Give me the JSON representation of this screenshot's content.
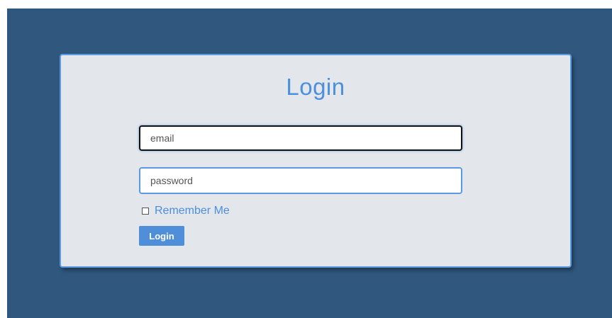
{
  "form": {
    "title": "Login",
    "email_placeholder": "email",
    "password_placeholder": "password",
    "remember_label": "Remember Me",
    "remember_checked": false,
    "submit_label": "Login"
  },
  "colors": {
    "background": "#30587f",
    "card": "#e3e6ea",
    "accent": "#4d8fdc",
    "button": "#4f8fda"
  }
}
